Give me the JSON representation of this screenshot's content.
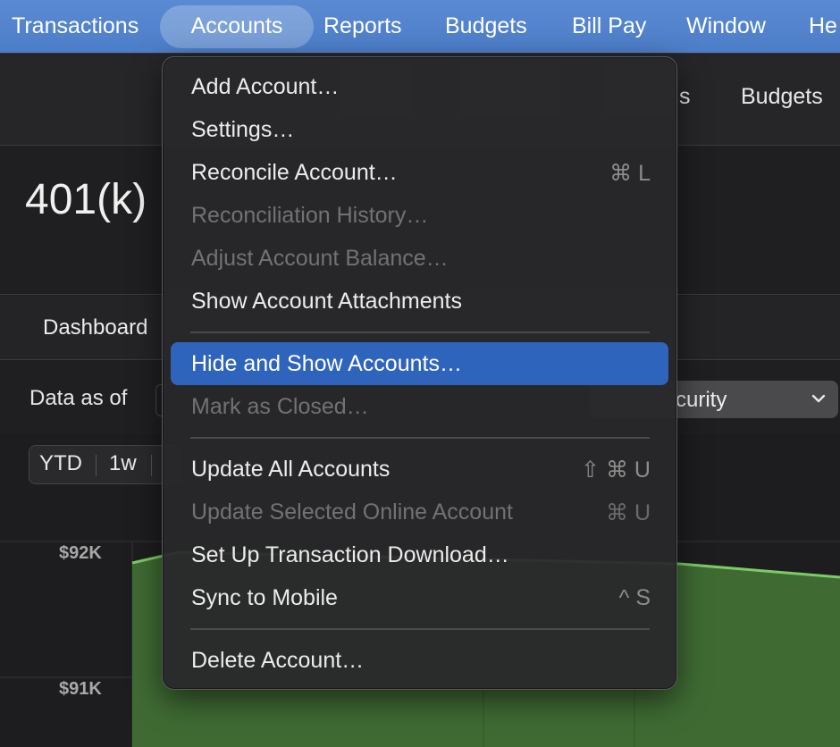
{
  "menubar": {
    "items": [
      "Transactions",
      "Accounts",
      "Reports",
      "Budgets",
      "Bill Pay",
      "Window",
      "He"
    ],
    "active": "Accounts"
  },
  "toolbar": {
    "visible_items": [
      "s",
      "Budgets"
    ]
  },
  "account": {
    "title": "401(k)"
  },
  "tabs": {
    "dashboard_label": "Dashboard"
  },
  "filters": {
    "data_as_of_label": "Data as of",
    "security_select_value": "curity"
  },
  "range_selector": {
    "options": [
      "YTD",
      "1w"
    ]
  },
  "chart_data": {
    "type": "area",
    "y_tick_labels": [
      "$92K",
      "$91K"
    ],
    "series_color": "#6fbf5a"
  },
  "accounts_menu": {
    "items": [
      {
        "label": "Add Account…",
        "shortcut": "",
        "enabled": true
      },
      {
        "label": "Settings…",
        "shortcut": "",
        "enabled": true
      },
      {
        "label": "Reconcile Account…",
        "shortcut": "⌘ L",
        "enabled": true
      },
      {
        "label": "Reconciliation History…",
        "shortcut": "",
        "enabled": false
      },
      {
        "label": "Adjust Account Balance…",
        "shortcut": "",
        "enabled": false
      },
      {
        "label": "Show Account Attachments",
        "shortcut": "",
        "enabled": true
      },
      {
        "label": "Hide and Show Accounts…",
        "shortcut": "",
        "enabled": true,
        "highlighted": true
      },
      {
        "label": "Mark as Closed…",
        "shortcut": "",
        "enabled": false
      },
      {
        "label": "Update All Accounts",
        "shortcut": "⇧ ⌘ U",
        "enabled": true
      },
      {
        "label": "Update Selected Online Account",
        "shortcut": "⌘ U",
        "enabled": false
      },
      {
        "label": "Set Up Transaction Download…",
        "shortcut": "",
        "enabled": true
      },
      {
        "label": "Sync to Mobile",
        "shortcut": "^ S",
        "enabled": true
      },
      {
        "label": "Delete Account…",
        "shortcut": "",
        "enabled": true
      }
    ]
  },
  "colors": {
    "menubar": "#4c7dc7",
    "menu_highlight": "#2f64bd",
    "chart_fill": "#4f8a3a",
    "chart_line": "#6fbf5a"
  }
}
